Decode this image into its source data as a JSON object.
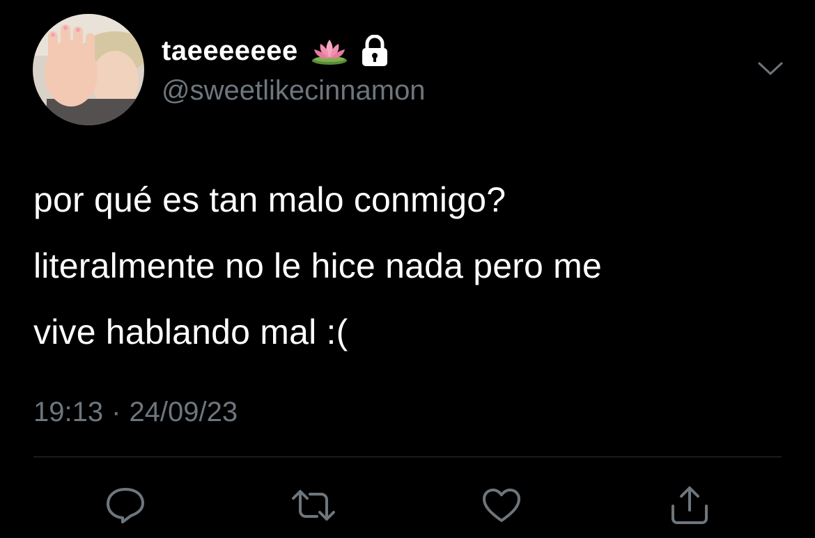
{
  "user": {
    "display_name": "taeeeeeee",
    "handle": "@sweetlikecinnamon",
    "name_emoji_icon": "lotus-icon",
    "protected_icon": "lock-icon",
    "avatar_icon": "avatar"
  },
  "tweet": {
    "lines": [
      "por qué es tan malo conmigo?",
      "literalmente no le hice nada pero me",
      "vive hablando mal :("
    ],
    "time": "19:13",
    "separator": "·",
    "date": "24/09/23"
  },
  "actions": [
    {
      "icon": "reply-icon"
    },
    {
      "icon": "retweet-icon"
    },
    {
      "icon": "like-icon"
    },
    {
      "icon": "share-icon"
    }
  ],
  "colors": {
    "background": "#000000",
    "primary_text": "#ffffff",
    "secondary_text": "#6e767d",
    "divider": "#2f3336"
  }
}
